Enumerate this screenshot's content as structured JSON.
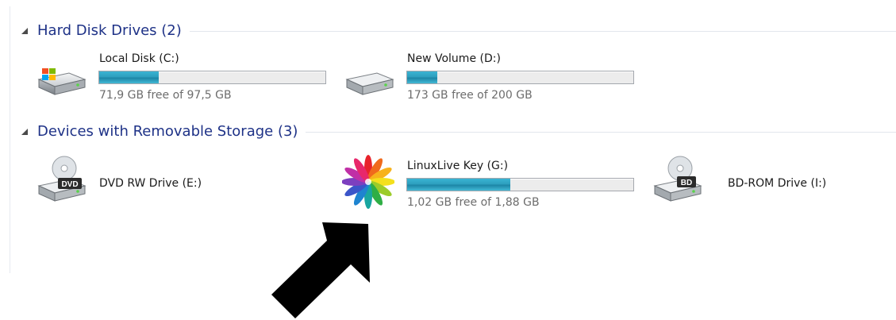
{
  "groups": {
    "hdd": {
      "title": "Hard Disk Drives (2)"
    },
    "removable": {
      "title": "Devices with Removable Storage (3)"
    }
  },
  "drives": {
    "c": {
      "name": "Local Disk (C:)",
      "free_text": "71,9 GB free of 97,5 GB",
      "used_fraction": 0.263,
      "icon": "windows-drive-icon"
    },
    "d": {
      "name": "New Volume (D:)",
      "free_text": "173 GB free of 200 GB",
      "used_fraction": 0.135,
      "icon": "hard-drive-icon"
    },
    "e": {
      "name": "DVD RW Drive (E:)",
      "icon": "dvd-drive-icon",
      "badge": "DVD"
    },
    "g": {
      "name": "LinuxLive Key (G:)",
      "free_text": "1,02 GB free of 1,88 GB",
      "used_fraction": 0.457,
      "icon": "linuxlive-flower-icon"
    },
    "i": {
      "name": "BD-ROM Drive (I:)",
      "icon": "bd-drive-icon",
      "badge": "BD"
    }
  },
  "colors": {
    "group_title": "#1e3287",
    "bar_fill": "#2d9fbe",
    "free_text": "#6d6d6d",
    "arrow": "#000000"
  },
  "annotation": {
    "icon": "arrow-pointing-icon"
  }
}
